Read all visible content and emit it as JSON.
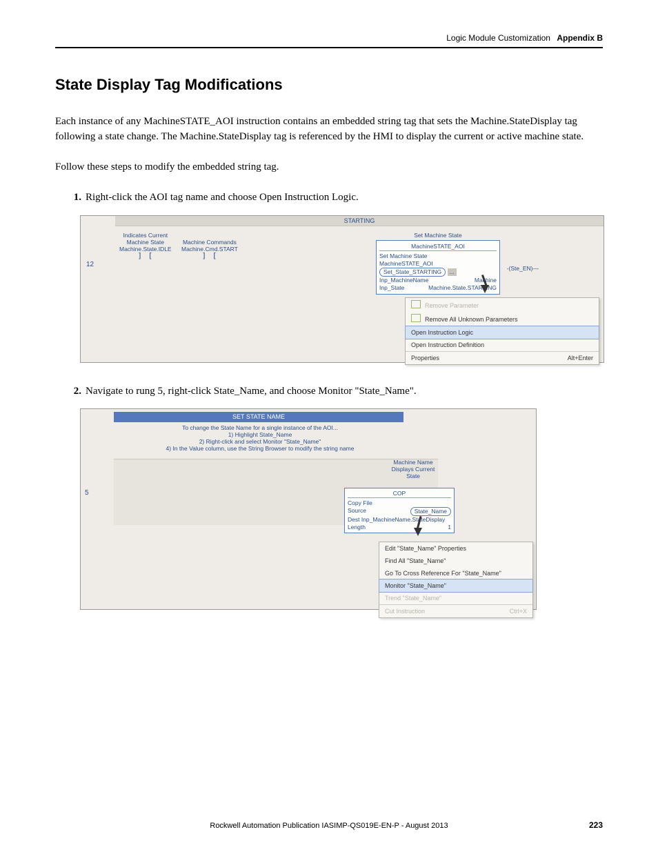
{
  "header": {
    "chapter": "Logic Module Customization",
    "appendix": "Appendix B"
  },
  "section_title": "State Display Tag Modifications",
  "paragraphs": {
    "p1": "Each instance of any MachineSTATE_AOI instruction contains an embedded string tag that sets the Machine.StateDisplay tag following a state change. The Machine.StateDisplay tag is referenced by the HMI to display the current or active machine state.",
    "p2": "Follow these steps to modify the embedded string tag."
  },
  "steps": {
    "s1": {
      "num": "1.",
      "text": "Right-click the AOI tag name and choose Open Instruction Logic."
    },
    "s2": {
      "num": "2.",
      "text": "Navigate to rung 5, right-click State_Name, and choose Monitor \"State_Name\"."
    }
  },
  "figure1": {
    "routine_label": "STARTING",
    "rung_number": "12",
    "left_col1_l1": "Indicates Current",
    "left_col1_l2": "Machine State",
    "left_col1_l3": "Machine.State.IDLE",
    "left_col2_l1": "Machine Commands",
    "left_col2_l2": "Machine.Cmd.START",
    "contact_glyph": "] [",
    "right_title": "Set Machine State",
    "aoi_header": "MachineSTATE_AOI",
    "aoi_row1_label": "Set Machine State",
    "aoi_row2_left": "MachineSTATE_AOI",
    "aoi_row2_oval": "Set_State_STARTING",
    "aoi_row2_btn": "...",
    "aoi_row3_left": "Inp_MachineName",
    "aoi_row3_right": "Machine",
    "aoi_row4_left": "Inp_State",
    "aoi_row4_right": "Machine.State.STARTING",
    "ste_en": "-(Ste_EN)—",
    "menu": {
      "m1": "Remove Parameter",
      "m2": "Remove All Unknown Parameters",
      "m3": "Open Instruction Logic",
      "m4": "Open Instruction Definition",
      "m5": "Properties",
      "m5_shortcut": "Alt+Enter"
    }
  },
  "figure2": {
    "title_bar": "SET STATE NAME",
    "comment_l1": "To change the State Name for a single instance of the AOI...",
    "comment_l2": "1) Highlight State_Name",
    "comment_l3": "2) Right-click and select Monitor \"State_Name\"",
    "comment_l4": "4) In the Value column, use the String Browser to modify the string name",
    "rung_number": "5",
    "mname_l1": "Machine Name",
    "mname_l2": "Displays Current",
    "mname_l3": "State",
    "cop_header": "COP",
    "cop_l1": "Copy File",
    "cop_source_label": "Source",
    "cop_source_oval": "State_Name",
    "cop_dest": "Dest   Inp_MachineName.StateDisplay",
    "cop_length_label": "Length",
    "cop_length_val": "1",
    "menu": {
      "m1": "Edit \"State_Name\" Properties",
      "m2": "Find All \"State_Name\"",
      "m3": "Go To Cross Reference For \"State_Name\"",
      "m4": "Monitor \"State_Name\"",
      "m5": "Trend \"State_Name\"",
      "m6": "Cut Instruction",
      "m6_shortcut": "Ctrl+X"
    }
  },
  "footer": {
    "pub": "Rockwell Automation Publication IASIMP-QS019E-EN-P - August 2013",
    "page": "223"
  }
}
